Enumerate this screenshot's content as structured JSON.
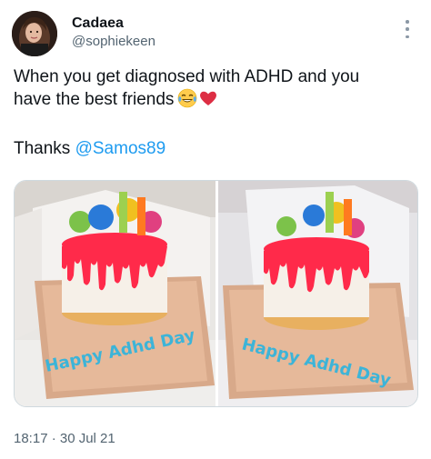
{
  "author": {
    "display_name": "Cadaea",
    "handle": "@sophiekeen"
  },
  "tweet": {
    "line1": "When you get diagnosed with ADHD and you",
    "line2": "have the best friends",
    "thanks": "Thanks",
    "mention": "@Samos89",
    "emojis": [
      "tears-of-joy-emoji",
      "red-heart-emoji"
    ]
  },
  "media": {
    "photo_count": 2,
    "cake_text_left": "Happy Adhd Day",
    "cake_text_right": "Happy Adhd Day"
  },
  "meta": {
    "timestamp": "18:17 · 30 Jul 21"
  },
  "colors": {
    "accent": "#1d9bf0",
    "muted": "#536471",
    "text": "#0f1419"
  },
  "icons": [
    "more-options-icon"
  ]
}
